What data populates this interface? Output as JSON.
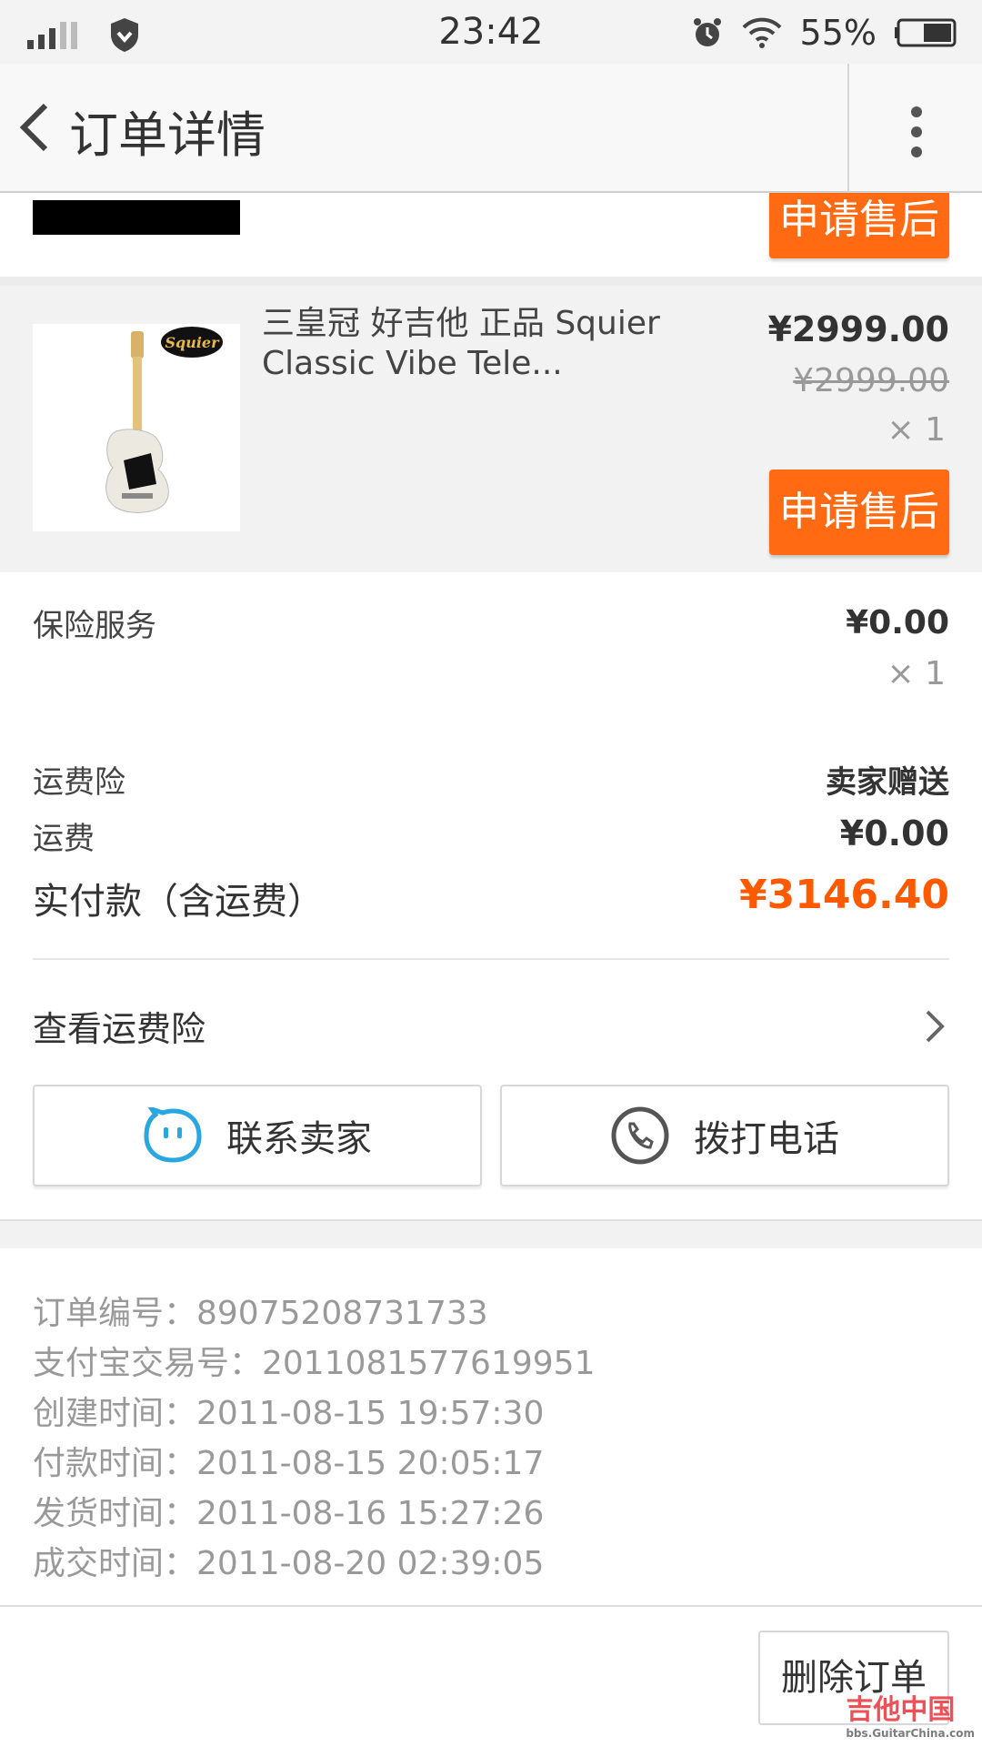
{
  "status": {
    "time": "23:42",
    "battery": "55%"
  },
  "nav": {
    "title": "订单详情"
  },
  "prev_item": {
    "after_sale_label": "申请售后"
  },
  "item": {
    "title": "三皇冠 好吉他 正品 Squier Classic Vibe Tele...",
    "price_now": "¥2999.00",
    "price_old": "¥2999.00",
    "qty": "× 1",
    "after_sale_label": "申请售后",
    "brand_logo_text": "Squier"
  },
  "insurance": {
    "label": "保险服务",
    "price": "¥0.00",
    "qty": "× 1"
  },
  "freight_insurance": {
    "label": "运费险",
    "value": "卖家赠送"
  },
  "freight": {
    "label": "运费",
    "value": "¥0.00"
  },
  "paid": {
    "label": "实付款（含运费）",
    "value": "¥3146.40"
  },
  "view_freight_insurance": {
    "label": "查看运费险"
  },
  "actions": {
    "contact_seller": "联系卖家",
    "call": "拨打电话"
  },
  "order_info": {
    "order_no": "订单编号：89075208731733",
    "alipay_no": "支付宝交易号：2011081577619951",
    "created": "创建时间：2011-08-15 19:57:30",
    "paid_time": "付款时间：2011-08-15 20:05:17",
    "shipped": "发货时间：2011-08-16 15:27:26",
    "closed": "成交时间：2011-08-20 02:39:05"
  },
  "footer": {
    "delete_order": "删除订单"
  },
  "watermark": {
    "text": "吉他中国",
    "sub": "bbs.GuitarChina.com"
  },
  "colors": {
    "accent": "#ff6a12",
    "price": "#ff5a00",
    "icon_blue": "#2aa6e0"
  }
}
